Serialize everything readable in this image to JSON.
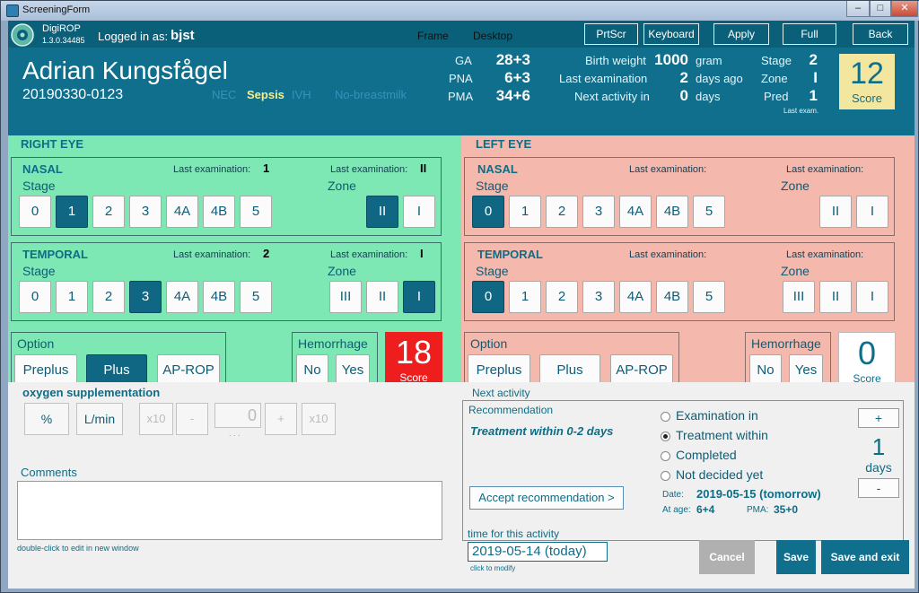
{
  "window": {
    "title": "ScreeningForm"
  },
  "topbar": {
    "app_name": "DigiROP",
    "version": "1.3.0.34485",
    "logged_in_label": "Logged in as:",
    "username": "bjst",
    "frame_label": "Frame",
    "desktop_label": "Desktop",
    "buttons": {
      "prtscr": "PrtScr",
      "keyboard": "Keyboard",
      "apply": "Apply",
      "full": "Full",
      "back": "Back"
    }
  },
  "patient": {
    "name": "Adrian Kungsfågel",
    "id": "20190330-0123",
    "flags": {
      "nec": "NEC",
      "sepsis": "Sepsis",
      "ivh": "IVH",
      "breastmilk": "No-breastmilk"
    },
    "ga_label": "GA",
    "ga": "28+3",
    "pna_label": "PNA",
    "pna": "6+3",
    "pma_label": "PMA",
    "pma": "34+6",
    "birth_weight_label": "Birth weight",
    "birth_weight": "1000",
    "birth_weight_unit": "gram",
    "last_exam_label": "Last examination",
    "last_exam": "2",
    "last_exam_unit": "days ago",
    "next_activity_label": "Next activity in",
    "next_activity": "0",
    "next_activity_unit": "days",
    "stage_label": "Stage",
    "stage": "2",
    "zone_label": "Zone",
    "zone": "I",
    "pred_label": "Pred",
    "pred": "1",
    "last_exam_note": "Last exam.",
    "score": "12",
    "score_label": "Score"
  },
  "right_eye": {
    "title": "RIGHT EYE",
    "nasal": {
      "title": "NASAL",
      "stage_label": "Stage",
      "zone_label": "Zone",
      "last_exam_label": "Last examination:",
      "last_stage": "1",
      "last_zone": "II",
      "stages": [
        "0",
        "1",
        "2",
        "3",
        "4A",
        "4B",
        "5"
      ],
      "zones": [
        "II",
        "I"
      ]
    },
    "temporal": {
      "title": "TEMPORAL",
      "stage_label": "Stage",
      "zone_label": "Zone",
      "last_exam_label": "Last examination:",
      "last_stage": "2",
      "last_zone": "I",
      "stages": [
        "0",
        "1",
        "2",
        "3",
        "4A",
        "4B",
        "5"
      ],
      "zones": [
        "III",
        "II",
        "I"
      ]
    },
    "option": {
      "title": "Option",
      "preplus": "Preplus",
      "plus": "Plus",
      "aprop": "AP-ROP"
    },
    "hemorrhage": {
      "title": "Hemorrhage",
      "no": "No",
      "yes": "Yes"
    },
    "score": "18",
    "score_label": "Score"
  },
  "left_eye": {
    "title": "LEFT EYE",
    "nasal": {
      "title": "NASAL",
      "stage_label": "Stage",
      "zone_label": "Zone",
      "last_exam_label": "Last examination:",
      "stages": [
        "0",
        "1",
        "2",
        "3",
        "4A",
        "4B",
        "5"
      ],
      "zones": [
        "II",
        "I"
      ]
    },
    "temporal": {
      "title": "TEMPORAL",
      "stage_label": "Stage",
      "zone_label": "Zone",
      "last_exam_label": "Last examination:",
      "stages": [
        "0",
        "1",
        "2",
        "3",
        "4A",
        "4B",
        "5"
      ],
      "zones": [
        "III",
        "II",
        "I"
      ]
    },
    "option": {
      "title": "Option",
      "preplus": "Preplus",
      "plus": "Plus",
      "aprop": "AP-ROP"
    },
    "hemorrhage": {
      "title": "Hemorrhage",
      "no": "No",
      "yes": "Yes"
    },
    "score": "0",
    "score_label": "Score"
  },
  "oxygen": {
    "title": "oxygen supplementation",
    "percent": "%",
    "lmin": "L/min",
    "x10a": "x10",
    "minus": "-",
    "value": "0",
    "plus": "+",
    "x10b": "x10",
    "dots": ". . ."
  },
  "comments": {
    "title": "Comments",
    "hint": "double-click to edit in new window"
  },
  "next_activity": {
    "title": "Next activity",
    "recommendation_title": "Recommendation",
    "recommendation": "Treatment within 0-2 days",
    "accept_button": "Accept recommendation  >",
    "options": [
      "Examination in",
      "Treatment within",
      "Completed",
      "Not decided yet"
    ],
    "selected_index": 1,
    "plus": "+",
    "days_value": "1",
    "days_label": "days",
    "minus": "-",
    "date_label": "Date:",
    "date": "2019-05-15 (tomorrow)",
    "at_age_label": "At age:",
    "at_age": "6+4",
    "pma_label": "PMA:",
    "pma": "35+0"
  },
  "time_for_activity": {
    "title": "time for this activity",
    "value": "2019-05-14 (today)",
    "hint": "click to modify"
  },
  "actions": {
    "cancel": "Cancel",
    "save": "Save",
    "save_exit": "Save and exit"
  },
  "colors": {
    "teal_dark": "#0b6079",
    "teal": "#0f6f8c",
    "right_bg": "#7ee8b4",
    "left_bg": "#f4b8ac",
    "score_red": "#ef1e1e",
    "score_yellow": "#f3e7a0"
  }
}
